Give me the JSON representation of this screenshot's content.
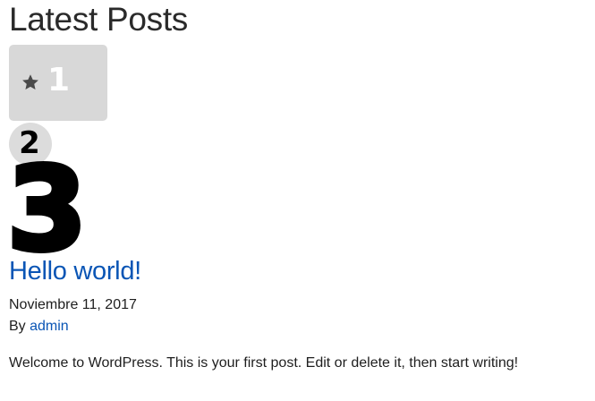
{
  "block": {
    "heading": "Latest Posts"
  },
  "ratings": {
    "first_number": "1",
    "first_icon": "star-icon",
    "second_number": "2",
    "third_number": "3"
  },
  "post": {
    "title": "Hello world!",
    "date": "Noviembre 11, 2017",
    "by_label": "By",
    "author": "admin",
    "excerpt": "Welcome to WordPress. This is your first post. Edit or delete it, then start writing!"
  },
  "colors": {
    "link": "#0a55b5",
    "badge_gray": "#d8d8d8",
    "text": "#1e1e1e"
  }
}
